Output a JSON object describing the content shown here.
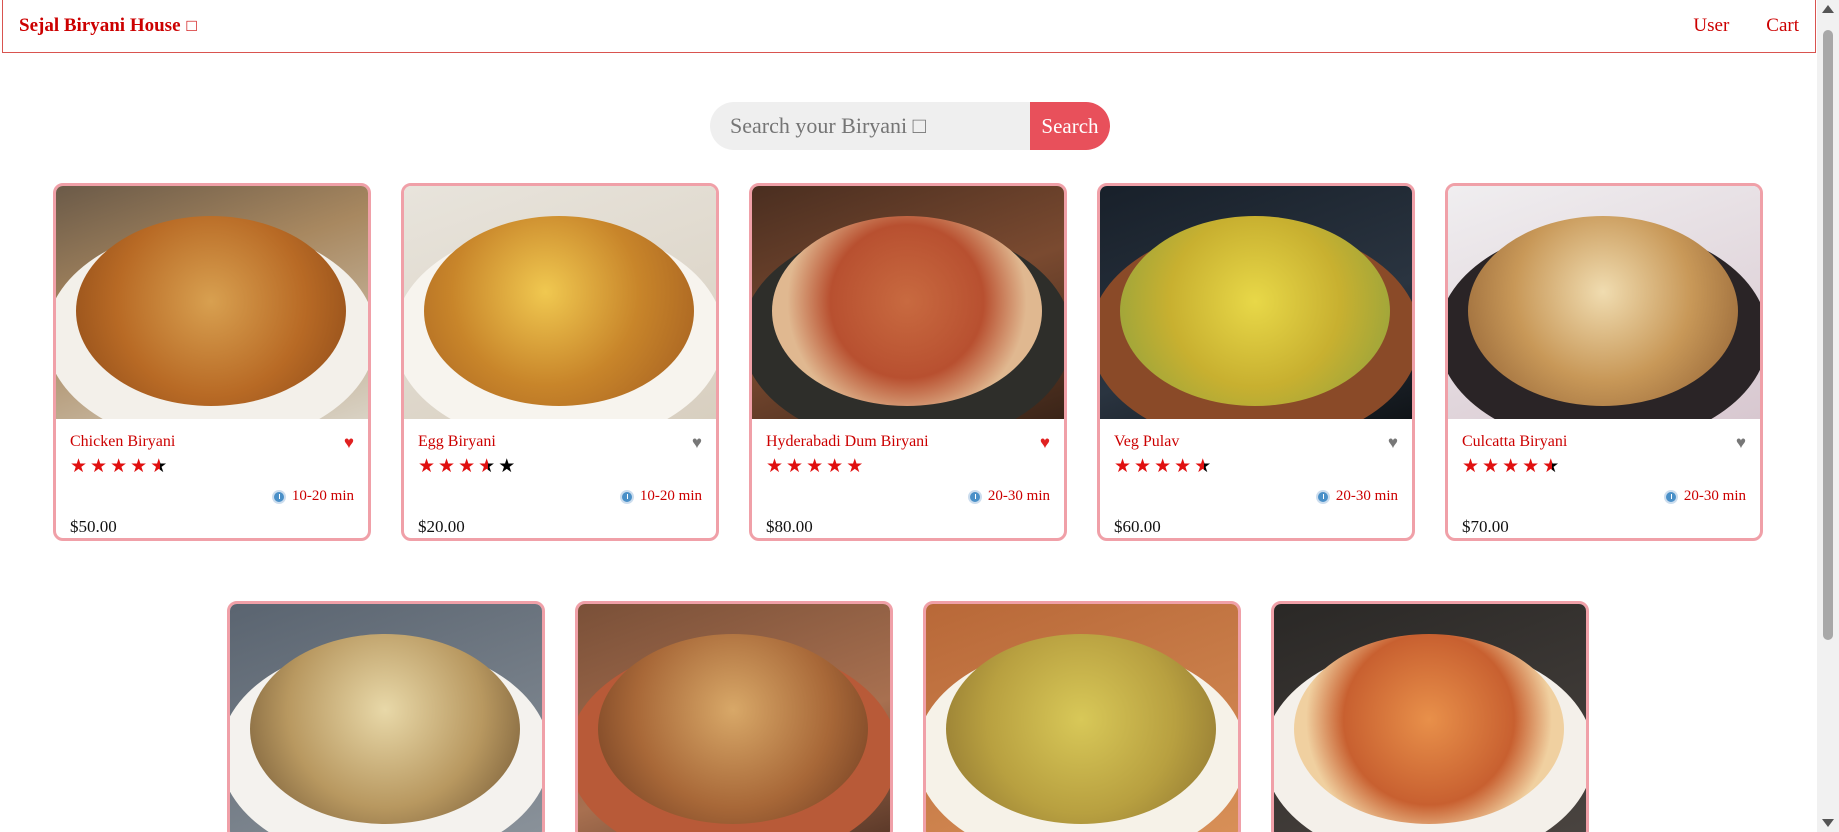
{
  "navbar": {
    "brand": "Sejal Biryani House",
    "brand_glyph": "□",
    "links": [
      "User",
      "Cart"
    ]
  },
  "search": {
    "placeholder": "Search your Biryani □",
    "button_label": "Search"
  },
  "colors": {
    "accent": "#e8505b",
    "brand_red": "#cc0000",
    "card_border": "#f0a0a8",
    "star_red": "#e01010"
  },
  "dishes": [
    {
      "name": "Chicken Biryani",
      "rating": 4.5,
      "liked": true,
      "time": "10-20 min",
      "price": "$50.00"
    },
    {
      "name": "Egg Biryani",
      "rating": 3.5,
      "liked": false,
      "time": "10-20 min",
      "price": "$20.00"
    },
    {
      "name": "Hyderabadi Dum Biryani",
      "rating": 5,
      "liked": true,
      "time": "20-30 min",
      "price": "$80.00"
    },
    {
      "name": "Veg Pulav",
      "rating": 4.5,
      "liked": false,
      "time": "20-30 min",
      "price": "$60.00"
    },
    {
      "name": "Culcatta Biryani",
      "rating": 4.5,
      "liked": false,
      "time": "20-30 min",
      "price": "$70.00"
    }
  ],
  "second_row_count": 4,
  "icons": {
    "heart": "heart-icon",
    "clock": "clock-icon",
    "star": "star-icon"
  }
}
